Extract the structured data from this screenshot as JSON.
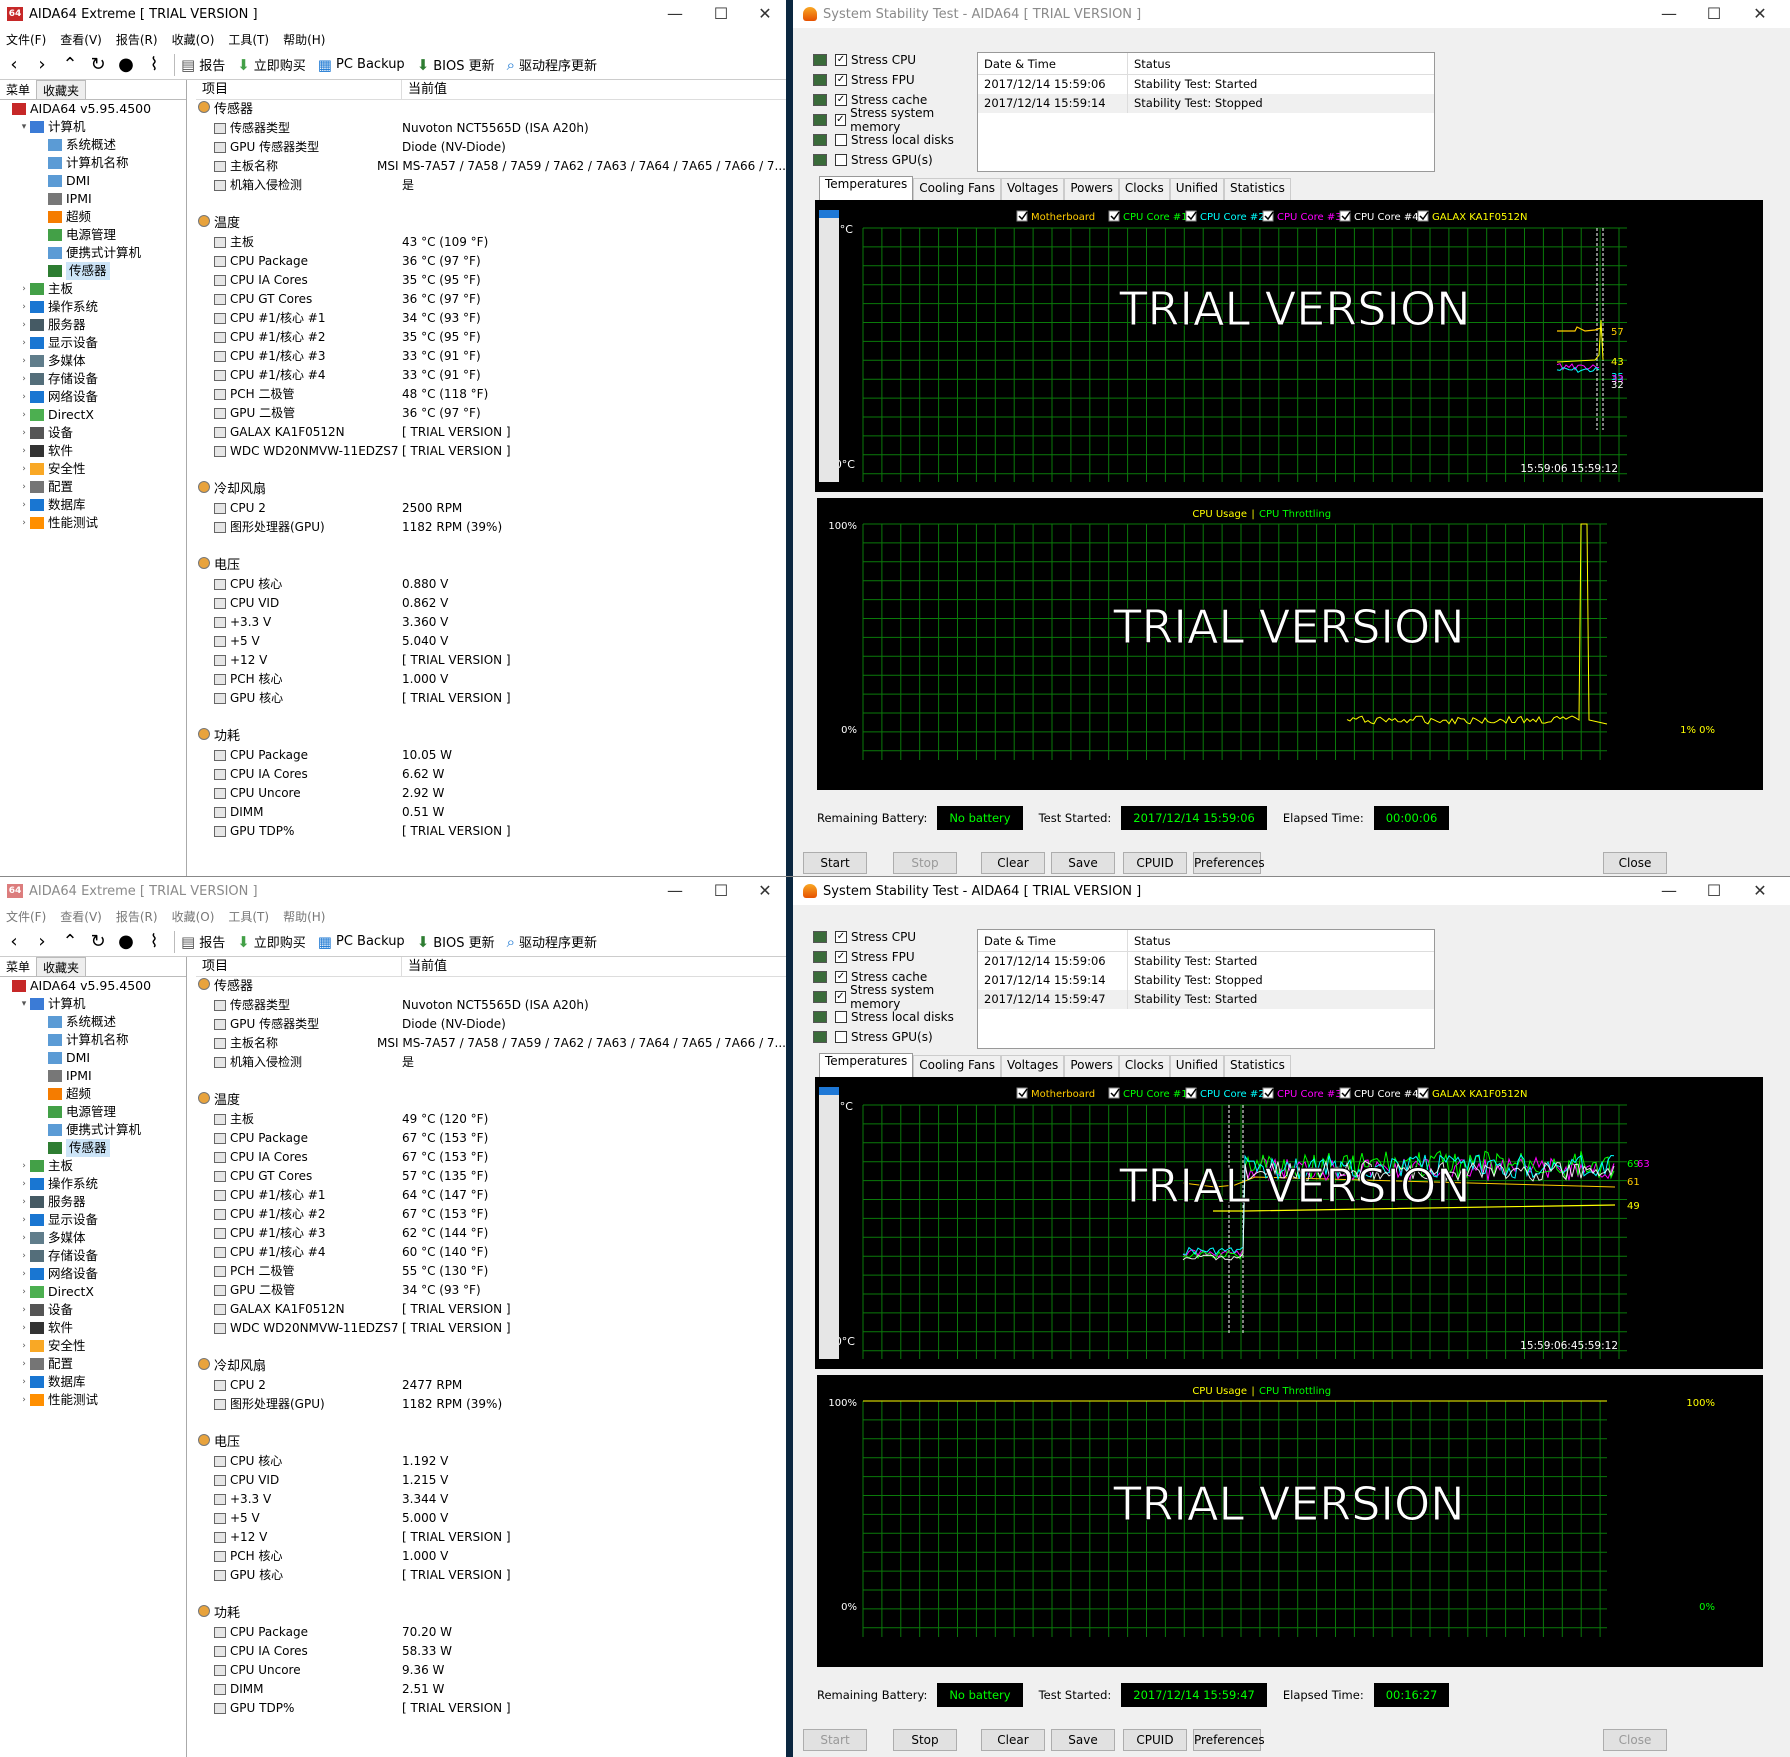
{
  "aida_windows": [
    {
      "title": "AIDA64 Extreme  [ TRIAL VERSION ]",
      "menu": [
        "文件(F)",
        "查看(V)",
        "报告(R)",
        "收藏(O)",
        "工具(T)",
        "帮助(H)"
      ],
      "toolbar": [
        "报告",
        "立即购买",
        "PC Backup",
        "BIOS 更新",
        "驱动程序更新"
      ],
      "tabs": [
        "菜单",
        "收藏夹"
      ],
      "tree": [
        "AIDA64 v5.95.4500",
        "计算机",
        "系统概述",
        "计算机名称",
        "DMI",
        "IPMI",
        "超频",
        "电源管理",
        "便携式计算机",
        "传感器",
        "主板",
        "操作系统",
        "服务器",
        "显示设备",
        "多媒体",
        "存储设备",
        "网络设备",
        "DirectX",
        "设备",
        "软件",
        "安全性",
        "配置",
        "数据库",
        "性能测试"
      ],
      "col_item": "项目",
      "col_value": "当前值",
      "rows": [
        {
          "g": "传感器"
        },
        {
          "k": "传感器类型",
          "v": "Nuvoton NCT5565D  (ISA A20h)"
        },
        {
          "k": "GPU 传感器类型",
          "v": "Diode  (NV-Diode)"
        },
        {
          "k": "主板名称",
          "v": "MSI MS-7A57 / 7A58 / 7A59 / 7A62 / 7A63 / 7A64 / 7A65 / 7A66 / 7..."
        },
        {
          "k": "机箱入侵检测",
          "v": "是"
        },
        {
          "s": ""
        },
        {
          "g": "温度"
        },
        {
          "k": "主板",
          "v": "43 °C  (109 °F)"
        },
        {
          "k": "CPU Package",
          "v": "36 °C  (97 °F)"
        },
        {
          "k": "CPU IA Cores",
          "v": "35 °C  (95 °F)"
        },
        {
          "k": "CPU GT Cores",
          "v": "36 °C  (97 °F)"
        },
        {
          "k": "CPU #1/核心 #1",
          "v": "34 °C  (93 °F)"
        },
        {
          "k": "CPU #1/核心 #2",
          "v": "35 °C  (95 °F)"
        },
        {
          "k": "CPU #1/核心 #3",
          "v": "33 °C  (91 °F)"
        },
        {
          "k": "CPU #1/核心 #4",
          "v": "33 °C  (91 °F)"
        },
        {
          "k": "PCH 二极管",
          "v": "48 °C  (118 °F)"
        },
        {
          "k": "GPU 二极管",
          "v": "36 °C  (97 °F)"
        },
        {
          "k": "GALAX KA1F0512N",
          "v": "[ TRIAL VERSION ]"
        },
        {
          "k": "WDC WD20NMVW-11EDZS7",
          "v": "[ TRIAL VERSION ]"
        },
        {
          "s": ""
        },
        {
          "g": "冷却风扇"
        },
        {
          "k": "CPU 2",
          "v": "2500 RPM"
        },
        {
          "k": "图形处理器(GPU)",
          "v": "1182 RPM  (39%)"
        },
        {
          "s": ""
        },
        {
          "g": "电压"
        },
        {
          "k": "CPU 核心",
          "v": "0.880 V"
        },
        {
          "k": "CPU VID",
          "v": "0.862 V"
        },
        {
          "k": "+3.3 V",
          "v": "3.360 V"
        },
        {
          "k": "+5 V",
          "v": "5.040 V"
        },
        {
          "k": "+12 V",
          "v": "[ TRIAL VERSION ]"
        },
        {
          "k": "PCH 核心",
          "v": "1.000 V"
        },
        {
          "k": "GPU 核心",
          "v": "[ TRIAL VERSION ]"
        },
        {
          "s": ""
        },
        {
          "g": "功耗"
        },
        {
          "k": "CPU Package",
          "v": "10.05 W"
        },
        {
          "k": "CPU IA Cores",
          "v": "6.62 W"
        },
        {
          "k": "CPU Uncore",
          "v": "2.92 W"
        },
        {
          "k": "DIMM",
          "v": "0.51 W"
        },
        {
          "k": "GPU TDP%",
          "v": "[ TRIAL VERSION ]"
        }
      ]
    },
    {
      "title": "AIDA64 Extreme  [ TRIAL VERSION ]",
      "menu": [
        "文件(F)",
        "查看(V)",
        "报告(R)",
        "收藏(O)",
        "工具(T)",
        "帮助(H)"
      ],
      "toolbar": [
        "报告",
        "立即购买",
        "PC Backup",
        "BIOS 更新",
        "驱动程序更新"
      ],
      "tabs": [
        "菜单",
        "收藏夹"
      ],
      "tree": [
        "AIDA64 v5.95.4500",
        "计算机",
        "系统概述",
        "计算机名称",
        "DMI",
        "IPMI",
        "超频",
        "电源管理",
        "便携式计算机",
        "传感器",
        "主板",
        "操作系统",
        "服务器",
        "显示设备",
        "多媒体",
        "存储设备",
        "网络设备",
        "DirectX",
        "设备",
        "软件",
        "安全性",
        "配置",
        "数据库",
        "性能测试"
      ],
      "col_item": "项目",
      "col_value": "当前值",
      "rows": [
        {
          "g": "传感器"
        },
        {
          "k": "传感器类型",
          "v": "Nuvoton NCT5565D  (ISA A20h)"
        },
        {
          "k": "GPU 传感器类型",
          "v": "Diode  (NV-Diode)"
        },
        {
          "k": "主板名称",
          "v": "MSI MS-7A57 / 7A58 / 7A59 / 7A62 / 7A63 / 7A64 / 7A65 / 7A66 / 7..."
        },
        {
          "k": "机箱入侵检测",
          "v": "是"
        },
        {
          "s": ""
        },
        {
          "g": "温度"
        },
        {
          "k": "主板",
          "v": "49 °C  (120 °F)"
        },
        {
          "k": "CPU Package",
          "v": "67 °C  (153 °F)"
        },
        {
          "k": "CPU IA Cores",
          "v": "67 °C  (153 °F)"
        },
        {
          "k": "CPU GT Cores",
          "v": "57 °C  (135 °F)"
        },
        {
          "k": "CPU #1/核心 #1",
          "v": "64 °C  (147 °F)"
        },
        {
          "k": "CPU #1/核心 #2",
          "v": "67 °C  (153 °F)"
        },
        {
          "k": "CPU #1/核心 #3",
          "v": "62 °C  (144 °F)"
        },
        {
          "k": "CPU #1/核心 #4",
          "v": "60 °C  (140 °F)"
        },
        {
          "k": "PCH 二极管",
          "v": "55 °C  (130 °F)"
        },
        {
          "k": "GPU 二极管",
          "v": "34 °C  (93 °F)"
        },
        {
          "k": "GALAX KA1F0512N",
          "v": "[ TRIAL VERSION ]"
        },
        {
          "k": "WDC WD20NMVW-11EDZS7",
          "v": "[ TRIAL VERSION ]"
        },
        {
          "s": ""
        },
        {
          "g": "冷却风扇"
        },
        {
          "k": "CPU 2",
          "v": "2477 RPM"
        },
        {
          "k": "图形处理器(GPU)",
          "v": "1182 RPM  (39%)"
        },
        {
          "s": ""
        },
        {
          "g": "电压"
        },
        {
          "k": "CPU 核心",
          "v": "1.192 V"
        },
        {
          "k": "CPU VID",
          "v": "1.215 V"
        },
        {
          "k": "+3.3 V",
          "v": "3.344 V"
        },
        {
          "k": "+5 V",
          "v": "5.000 V"
        },
        {
          "k": "+12 V",
          "v": "[ TRIAL VERSION ]"
        },
        {
          "k": "PCH 核心",
          "v": "1.000 V"
        },
        {
          "k": "GPU 核心",
          "v": "[ TRIAL VERSION ]"
        },
        {
          "s": ""
        },
        {
          "g": "功耗"
        },
        {
          "k": "CPU Package",
          "v": "70.20 W"
        },
        {
          "k": "CPU IA Cores",
          "v": "58.33 W"
        },
        {
          "k": "CPU Uncore",
          "v": "9.36 W"
        },
        {
          "k": "DIMM",
          "v": "2.51 W"
        },
        {
          "k": "GPU TDP%",
          "v": "[ TRIAL VERSION ]"
        }
      ]
    }
  ],
  "stability_windows": [
    {
      "title": "System Stability Test - AIDA64  [ TRIAL VERSION ]",
      "stress": [
        {
          "label": "Stress CPU",
          "checked": true
        },
        {
          "label": "Stress FPU",
          "checked": true
        },
        {
          "label": "Stress cache",
          "checked": true
        },
        {
          "label": "Stress system memory",
          "checked": true
        },
        {
          "label": "Stress local disks",
          "checked": false
        },
        {
          "label": "Stress GPU(s)",
          "checked": false
        }
      ],
      "log_headers": [
        "Date & Time",
        "Status"
      ],
      "log": [
        [
          "2017/12/14 15:59:06",
          "Stability Test: Started"
        ],
        [
          "2017/12/14 15:59:14",
          "Stability Test: Stopped"
        ]
      ],
      "graph_tabs": [
        "Temperatures",
        "Cooling Fans",
        "Voltages",
        "Powers",
        "Clocks",
        "Unified",
        "Statistics"
      ],
      "legend": [
        {
          "label": "Motherboard",
          "color": "#ffcc00"
        },
        {
          "label": "CPU Core #1",
          "color": "#00ff00"
        },
        {
          "label": "CPU Core #2",
          "color": "#00ffff"
        },
        {
          "label": "CPU Core #3",
          "color": "#ff00ff"
        },
        {
          "label": "CPU Core #4",
          "color": "#ffffff"
        },
        {
          "label": "GALAX KA1F0512N",
          "color": "#ffff00"
        }
      ],
      "temp_top": "100°C",
      "temp_bottom": "0°C",
      "temp_time": "15:59:06 15:59:12",
      "temp_values": [
        "57",
        "43",
        "35",
        "33",
        "32"
      ],
      "watermark": "TRIAL VERSION",
      "usage_title_a": "CPU Usage",
      "usage_sep": "|",
      "usage_title_b": "CPU Throttling",
      "usage_top": "100%",
      "usage_bottom": "0%",
      "usage_right_top": "",
      "usage_right_bottom": "1% 0%",
      "battery_label": "Remaining Battery:",
      "battery_value": "No battery",
      "started_label": "Test Started:",
      "started_value": "2017/12/14 15:59:06",
      "elapsed_label": "Elapsed Time:",
      "elapsed_value": "00:00:06",
      "buttons": [
        "Start",
        "Stop",
        "Clear",
        "Save",
        "CPUID",
        "Preferences",
        "Close"
      ],
      "disabled": [
        false,
        true,
        false,
        false,
        false,
        false,
        false
      ]
    },
    {
      "title": "System Stability Test - AIDA64  [ TRIAL VERSION ]",
      "stress": [
        {
          "label": "Stress CPU",
          "checked": true
        },
        {
          "label": "Stress FPU",
          "checked": true
        },
        {
          "label": "Stress cache",
          "checked": true
        },
        {
          "label": "Stress system memory",
          "checked": true
        },
        {
          "label": "Stress local disks",
          "checked": false
        },
        {
          "label": "Stress GPU(s)",
          "checked": false
        }
      ],
      "log_headers": [
        "Date & Time",
        "Status"
      ],
      "log": [
        [
          "2017/12/14 15:59:06",
          "Stability Test: Started"
        ],
        [
          "2017/12/14 15:59:14",
          "Stability Test: Stopped"
        ],
        [
          "2017/12/14 15:59:47",
          "Stability Test: Started"
        ]
      ],
      "graph_tabs": [
        "Temperatures",
        "Cooling Fans",
        "Voltages",
        "Powers",
        "Clocks",
        "Unified",
        "Statistics"
      ],
      "legend": [
        {
          "label": "Motherboard",
          "color": "#ffcc00"
        },
        {
          "label": "CPU Core #1",
          "color": "#00ff00"
        },
        {
          "label": "CPU Core #2",
          "color": "#00ffff"
        },
        {
          "label": "CPU Core #3",
          "color": "#ff00ff"
        },
        {
          "label": "CPU Core #4",
          "color": "#ffffff"
        },
        {
          "label": "GALAX KA1F0512N",
          "color": "#ffff00"
        }
      ],
      "temp_top": "100°C",
      "temp_bottom": "0°C",
      "temp_time": "15:59:06:45:59:12",
      "temp_values": [
        "69",
        "63",
        "61",
        "49"
      ],
      "watermark": "TRIAL VERSION",
      "usage_title_a": "CPU Usage",
      "usage_sep": "|",
      "usage_title_b": "CPU Throttling",
      "usage_top": "100%",
      "usage_bottom": "0%",
      "usage_right_top": "100%",
      "usage_right_bottom": "0%",
      "battery_label": "Remaining Battery:",
      "battery_value": "No battery",
      "started_label": "Test Started:",
      "started_value": "2017/12/14 15:59:47",
      "elapsed_label": "Elapsed Time:",
      "elapsed_value": "00:16:27",
      "buttons": [
        "Start",
        "Stop",
        "Clear",
        "Save",
        "CPUID",
        "Preferences",
        "Close"
      ],
      "disabled": [
        true,
        false,
        false,
        false,
        false,
        false,
        true
      ]
    }
  ],
  "chart_data": [
    {
      "type": "line",
      "title": "",
      "ylim": [
        0,
        100
      ],
      "series": [
        {
          "name": "Motherboard",
          "values": [
            43,
            43,
            43
          ]
        },
        {
          "name": "CPU Core #1",
          "values": [
            34,
            57,
            35
          ]
        },
        {
          "name": "CPU Core #3",
          "values": [
            33,
            35,
            33
          ]
        }
      ]
    },
    {
      "type": "line",
      "title": "CPU Usage | CPU Throttling",
      "ylim": [
        0,
        100
      ],
      "series": [
        {
          "name": "CPU Usage",
          "values": [
            3,
            3,
            3,
            100,
            1
          ]
        }
      ]
    }
  ]
}
